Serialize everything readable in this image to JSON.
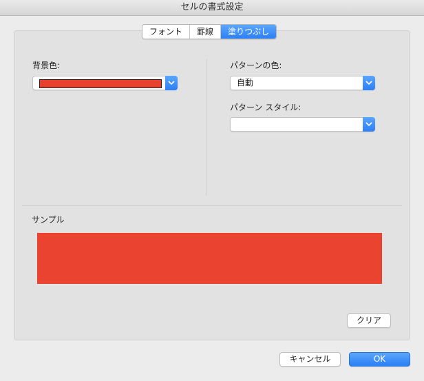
{
  "window": {
    "title": "セルの書式設定"
  },
  "tabs": [
    {
      "label": "フォント"
    },
    {
      "label": "罫線"
    },
    {
      "label": "塗りつぶし",
      "active": true
    }
  ],
  "fill": {
    "background_label": "背景色:",
    "background_color": "#e8412e",
    "pattern_color_label": "パターンの色:",
    "pattern_color_value": "自動",
    "pattern_style_label": "パターン スタイル:",
    "pattern_style_value": ""
  },
  "sample": {
    "label": "サンプル",
    "color": "#ea432f"
  },
  "buttons": {
    "clear": "クリア",
    "cancel": "キャンセル",
    "ok": "OK"
  },
  "colors": {
    "accent": "#2c7ff6"
  }
}
